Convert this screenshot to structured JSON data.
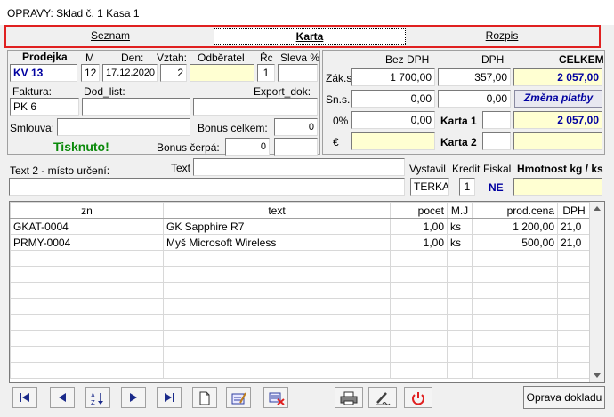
{
  "window": {
    "title": "OPRAVY: Sklad č. 1 Kasa 1"
  },
  "tabs": [
    {
      "label": "Seznam",
      "selected": false
    },
    {
      "label": "Karta",
      "selected": true
    },
    {
      "label": "Rozpis",
      "selected": false
    }
  ],
  "header": {
    "prodejka_label": "Prodejka",
    "prodejka_value": "KV  13",
    "m_label": "M",
    "m_value": "12",
    "den_label": "Den:",
    "den_value": "17.12.2020",
    "vztah_label": "Vztah:",
    "vztah_value": "2",
    "odberatel_label": "Odběratel",
    "odberatel_value": "",
    "rc_label": "Řc",
    "rc_value": "1",
    "sleva_label": "Sleva %",
    "sleva_value": "",
    "faktura_label": "Faktura:",
    "faktura_value": "PK  6",
    "dodlist_label": "Dod_list:",
    "dodlist_value": "",
    "exportdok_label": "Export_dok:",
    "exportdok_value": "",
    "smlouva_label": "Smlouva:",
    "smlouva_value": "",
    "bonus_celkem_label": "Bonus celkem:",
    "bonus_celkem_value": "0",
    "bonus_cerpa_label": "Bonus čerpá:",
    "bonus_cerpa_value": "0",
    "bonus_cerpa_extra": "",
    "tisknuto": "Tisknuto!"
  },
  "totals": {
    "col_bez_dph": "Bez DPH",
    "col_dph": "DPH",
    "col_celkem": "CELKEM",
    "zaks_label": "Zák.s.",
    "zaks_bez": "1 700,00",
    "zaks_dph": "357,00",
    "zaks_celkem": "2 057,00",
    "sns_label": "Sn.s.",
    "sns_bez": "0,00",
    "sns_dph": "0,00",
    "zmena_platby": "Změna platby",
    "pct0_label": "0%",
    "pct0_value": "0,00",
    "karta1_label": "Karta 1",
    "karta1_value": "",
    "karta1_total": "2 057,00",
    "eur_label": "€",
    "eur_value": "",
    "karta2_label": "Karta 2",
    "karta2_value": "",
    "karta2_total": ""
  },
  "info": {
    "text2_label": "Text 2 - místo určení:",
    "text2_value": "",
    "text_label": "Text",
    "text_value": "",
    "vystavil_label": "Vystavil",
    "vystavil_value": "TERKA",
    "kredit_label": "Kredit",
    "kredit_value": "1",
    "fiskal_label": "Fiskal",
    "fiskal_value": "NE",
    "hmotnost_label": "Hmotnost kg / ks",
    "hmotnost_value": ""
  },
  "grid": {
    "columns": [
      "zn",
      "text",
      "pocet",
      "M.J",
      "prod.cena",
      "DPH"
    ],
    "rows": [
      [
        "GKAT-0004",
        "GK Sapphire R7",
        "1,00",
        "ks",
        "1 200,00",
        "21,0"
      ],
      [
        "PRMY-0004",
        "Myš Microsoft Wireless",
        "1,00",
        "ks",
        "500,00",
        "21,0"
      ]
    ]
  },
  "toolbar": {
    "icons": [
      "first-record-icon",
      "previous-record-icon",
      "sort-az-icon",
      "next-record-icon",
      "last-record-icon",
      "new-document-icon",
      "edit-icon",
      "delete-icon",
      "print-icon",
      "signature-icon",
      "power-icon"
    ],
    "oprava_label": "Oprava dokladu"
  }
}
